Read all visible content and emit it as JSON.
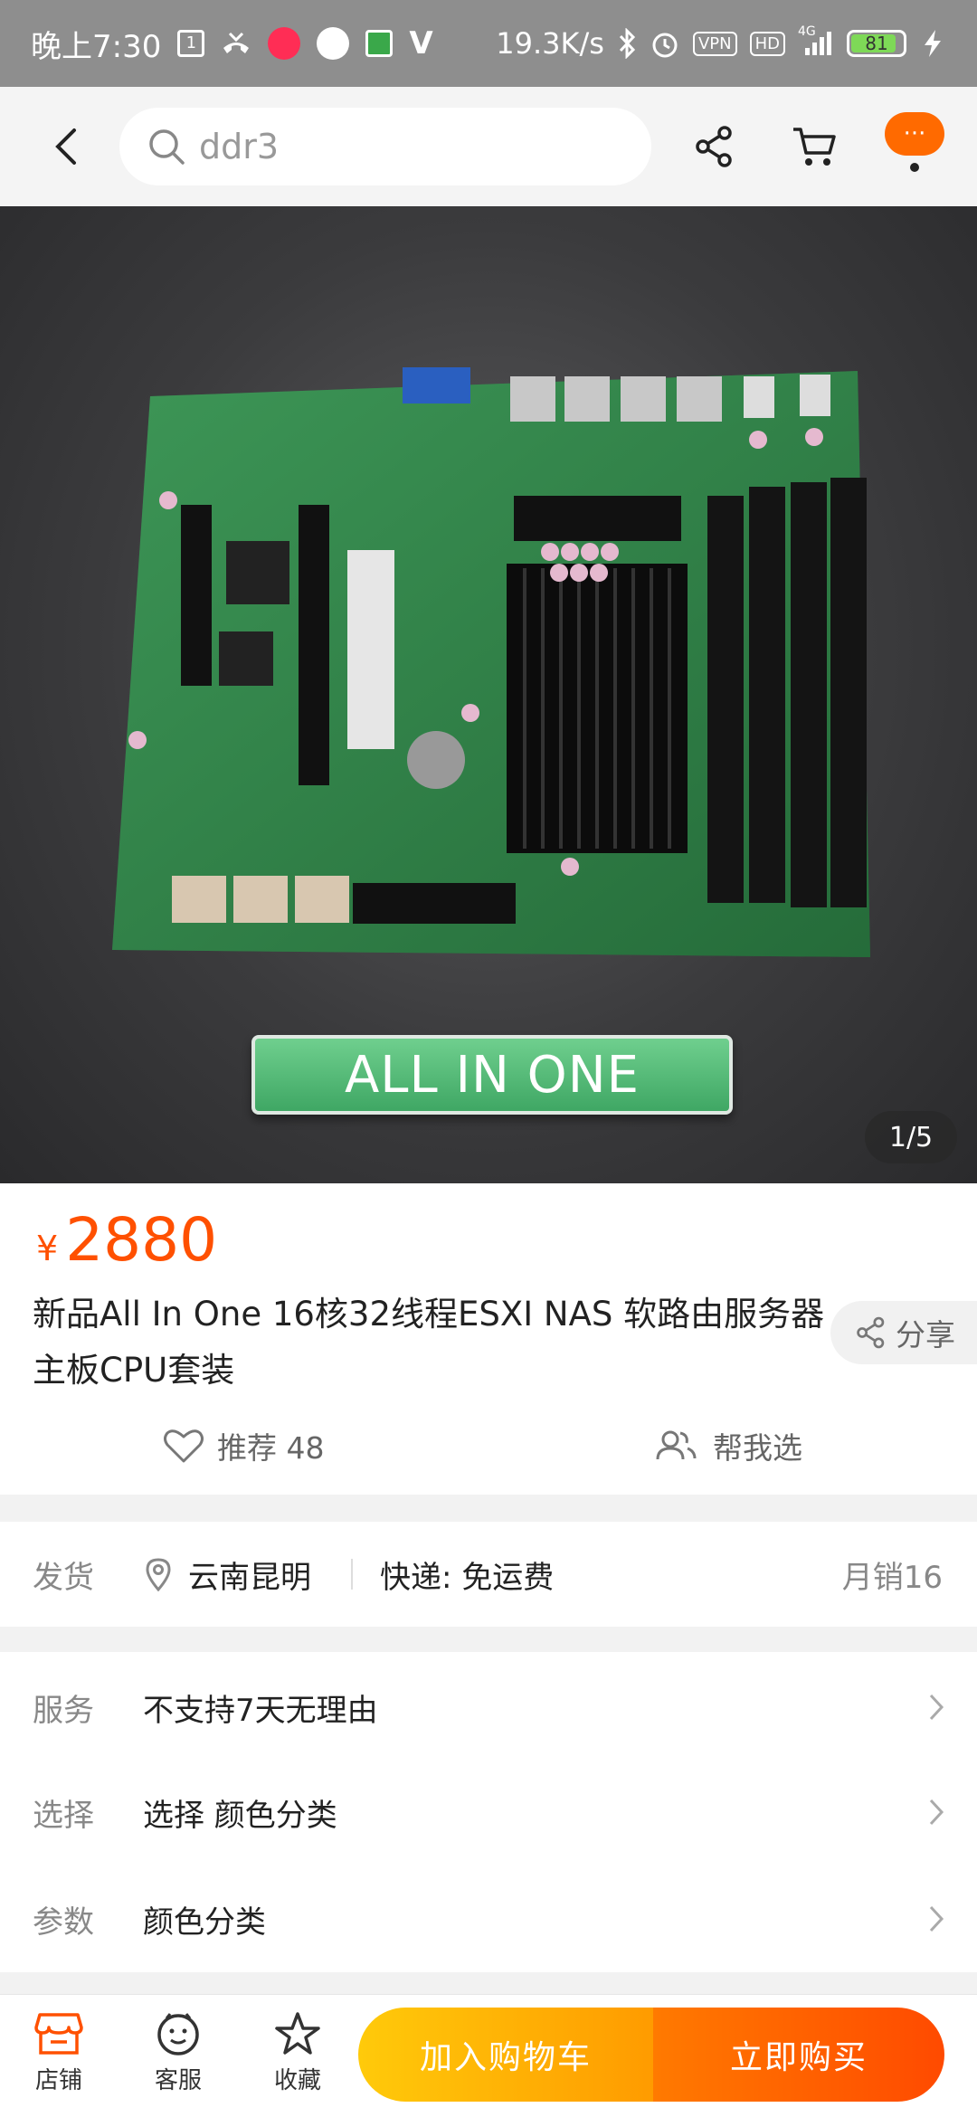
{
  "status_bar": {
    "time": "晚上7:30",
    "net_speed": "19.3K/s",
    "vpn": "VPN",
    "hd": "HD",
    "signal": "4G",
    "battery": "81",
    "battery_level": 0.81
  },
  "top_nav": {
    "search_placeholder": "ddr3",
    "more_label": "···"
  },
  "product_image": {
    "banner_text": "ALL IN ONE",
    "counter": "1/5"
  },
  "product": {
    "currency": "¥",
    "price": "2880",
    "title": "新品All In One 16核32线程ESXI NAS 软路由服务器主板CPU套装",
    "share_label": "分享",
    "recommend_label": "推荐 48",
    "help_choose_label": "帮我选"
  },
  "shipping": {
    "label": "发货",
    "location": "云南昆明",
    "express": "快递: 免运费",
    "monthly_sales": "月销16"
  },
  "services": [
    {
      "label": "服务",
      "value": "不支持7天无理由"
    },
    {
      "label": "选择",
      "value": "选择 颜色分类"
    },
    {
      "label": "参数",
      "value": "颜色分类"
    }
  ],
  "bottom_bar": {
    "store_label": "店铺",
    "service_label": "客服",
    "favorite_label": "收藏",
    "add_to_cart_label": "加入购物车",
    "buy_now_label": "立即购买"
  },
  "colors": {
    "accent": "#ff5000",
    "cart_gradient_start": "#ffca0a",
    "buy_gradient_end": "#ff4a00"
  }
}
